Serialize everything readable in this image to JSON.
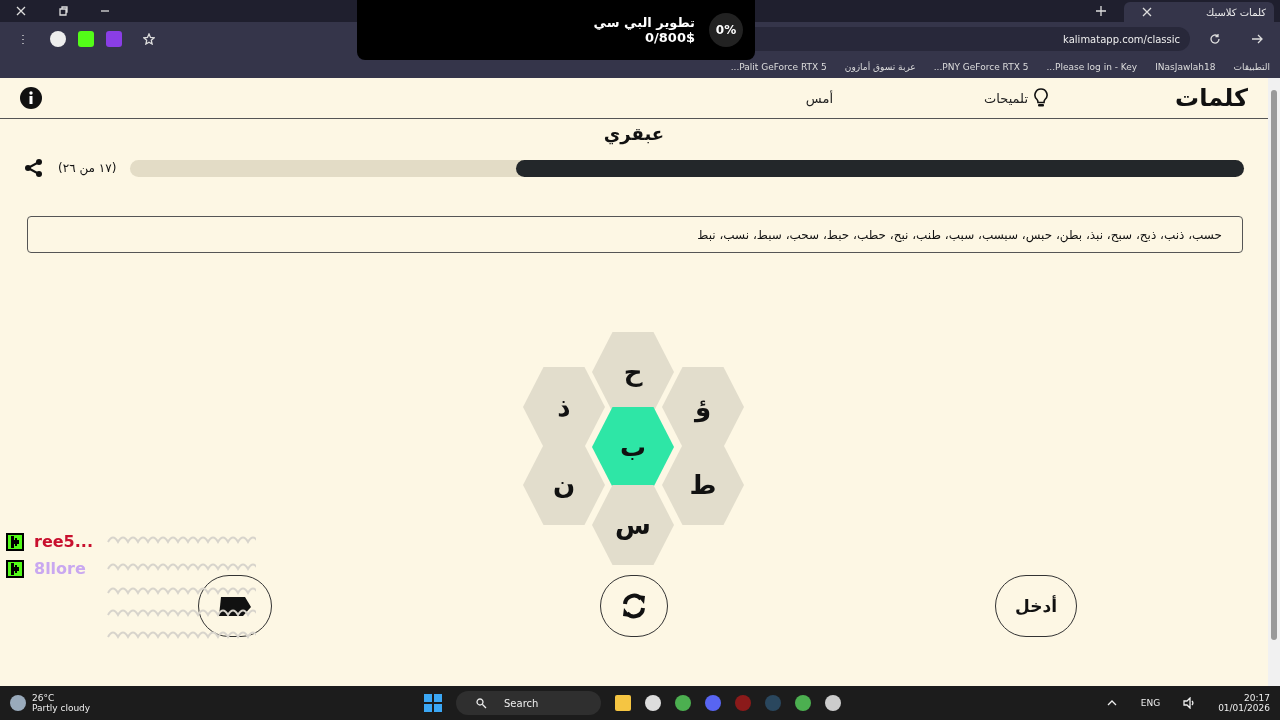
{
  "browser": {
    "tabs": [
      {
        "title": "كلمات كلاسيك",
        "selected": true
      }
    ],
    "url": "kalimatapp.com/classic",
    "bookmarks": [
      "التطبيقات",
      "INasJawlah18",
      "Please log in - Key...",
      "PNY GeForce RTX 5...",
      "عربة تسوق أمازون",
      "Palit GeForce RTX 5..."
    ]
  },
  "notification": {
    "percent": "0%",
    "title": "تطوير البي سي",
    "amount": "0/800$"
  },
  "header": {
    "logo": "كلمات",
    "nav": [
      {
        "kind": "hints",
        "label": "تلميحات"
      },
      {
        "kind": "plain",
        "label": "أمس"
      }
    ]
  },
  "rank": "عبقري",
  "progress": {
    "reading": "(١٧ من ٢٦)",
    "level": 0.654
  },
  "found_words": "حسب، ذنب، ذبح، سبح، نبذ، بطن، حبس، سبسب، سبب، طنب، نبح، حطب، حبط، سحب، سبط، نسب، نبط",
  "letters": [
    {
      "letter": "ح",
      "kind": "outer"
    },
    {
      "letter": "ذ",
      "kind": "outer"
    },
    {
      "letter": "ؤ",
      "kind": "outer"
    },
    {
      "letter": "ب",
      "kind": "center"
    },
    {
      "letter": "ن",
      "kind": "outer"
    },
    {
      "letter": "ط",
      "kind": "outer"
    },
    {
      "letter": "س",
      "kind": "outer"
    }
  ],
  "enter_button": "أدخل",
  "chat": [
    {
      "name": "ree5...",
      "color": "#c8102e"
    },
    {
      "name": "8llore",
      "color": "#c9a8f0"
    }
  ],
  "taskbar": {
    "temperature": "26°C",
    "weather": "Partly cloudy",
    "search": "Search",
    "language": "ENG",
    "time": "20:17",
    "date": "01/01/2026"
  }
}
